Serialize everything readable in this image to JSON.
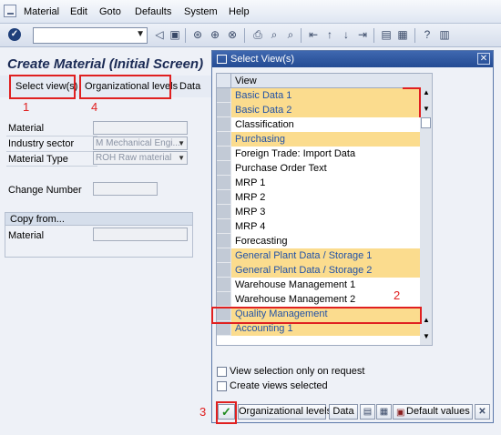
{
  "menu": {
    "items": [
      "Material",
      "Edit",
      "Goto",
      "Defaults",
      "System",
      "Help"
    ]
  },
  "toolbar": {
    "command_field_value": "",
    "icons": [
      "enter-icon",
      "back-icon",
      "save-icon",
      "back-green-icon",
      "exit-icon",
      "cancel-icon",
      "print-icon",
      "find-icon",
      "find-next-icon",
      "first-page-icon",
      "previous-page-icon",
      "next-page-icon",
      "last-page-icon",
      "create-session-icon",
      "shortcut-icon",
      "help-icon",
      "layout-icon"
    ]
  },
  "screen": {
    "title": "Create Material (Initial Screen)",
    "app_buttons": {
      "select_views": "Select view(s)",
      "org_levels": "Organizational levels",
      "data": "Data"
    },
    "annotations": {
      "n1": "1",
      "n2": "2",
      "n3": "3",
      "n4": "4"
    },
    "fields": {
      "material_label": "Material",
      "material_value": "",
      "industry_label": "Industry sector",
      "industry_value": "M Mechanical Engi...",
      "type_label": "Material Type",
      "type_value": "ROH Raw material",
      "change_label": "Change Number",
      "change_value": ""
    },
    "copy_from": {
      "title": "Copy from...",
      "material_label": "Material",
      "material_value": ""
    }
  },
  "dialog": {
    "title": "Select View(s)",
    "column_header": "View",
    "views": [
      {
        "label": "Basic Data 1",
        "selected": true
      },
      {
        "label": "Basic Data 2",
        "selected": true
      },
      {
        "label": "Classification",
        "selected": false
      },
      {
        "label": "Purchasing",
        "selected": true
      },
      {
        "label": "Foreign Trade: Import Data",
        "selected": false
      },
      {
        "label": "Purchase Order Text",
        "selected": false
      },
      {
        "label": "MRP 1",
        "selected": false
      },
      {
        "label": "MRP 2",
        "selected": false
      },
      {
        "label": "MRP 3",
        "selected": false
      },
      {
        "label": "MRP 4",
        "selected": false
      },
      {
        "label": "Forecasting",
        "selected": false
      },
      {
        "label": "General Plant Data / Storage 1",
        "selected": true
      },
      {
        "label": "General Plant Data / Storage 2",
        "selected": true
      },
      {
        "label": "Warehouse Management 1",
        "selected": false
      },
      {
        "label": "Warehouse Management 2",
        "selected": false
      },
      {
        "label": "Quality Management",
        "selected": true
      },
      {
        "label": "Accounting 1",
        "selected": true
      }
    ],
    "checkboxes": {
      "on_request": "View selection only on request",
      "create_selected": "Create views selected"
    },
    "footer": {
      "org_levels": "Organizational levels",
      "data": "Data",
      "default_values": "Default values"
    }
  }
}
